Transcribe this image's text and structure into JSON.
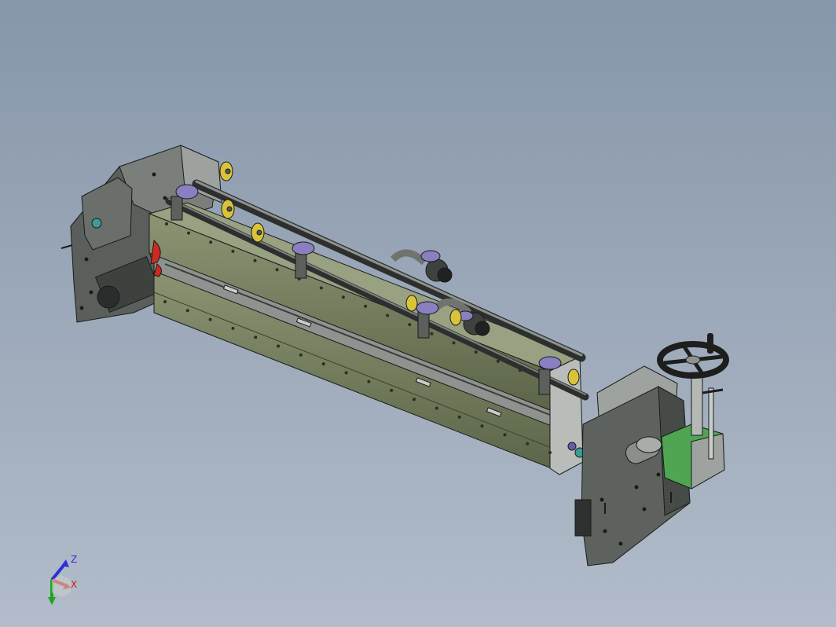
{
  "viewport": {
    "background_top": "#8796aa",
    "background_bottom": "#b2bcca"
  },
  "model": {
    "colors": {
      "plate_dark": "#4d524e",
      "plate_mid": "#6e736f",
      "plate_light": "#a9aeaa",
      "rail_green": "#6c7756",
      "rail_green_light": "#8b9473",
      "seal_red": "#cc2a24",
      "guard_green": "#4fa551",
      "knob_yellow": "#d9c33a",
      "handwheel": "#1d1f1d",
      "edge": "#1a1c1a"
    }
  },
  "triad": {
    "z_label": "Z",
    "x_label": "X",
    "z_color": "#2d2fd6",
    "x_color": "#cc1d1d",
    "y_color": "#1ea51e"
  }
}
